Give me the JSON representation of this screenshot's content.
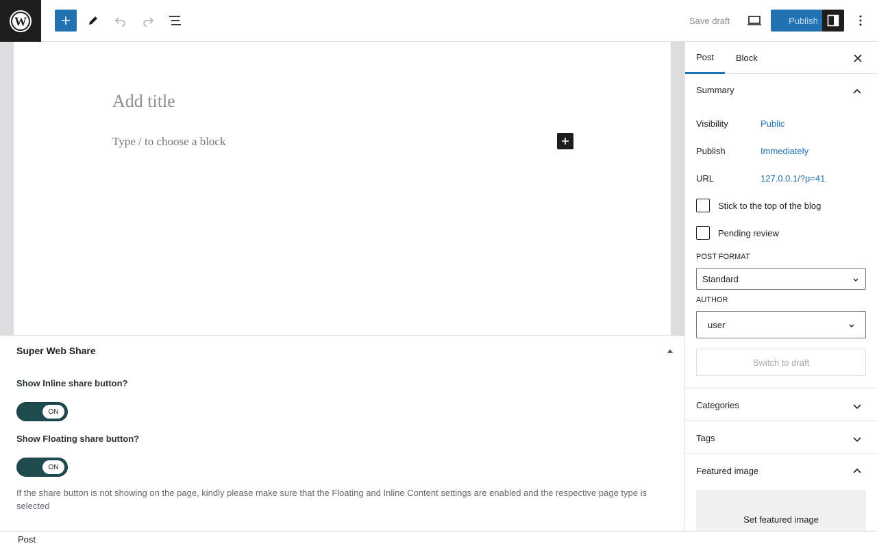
{
  "toolbar": {
    "logo_icon": "wordpress-logo",
    "save_draft": "Save draft",
    "publish": "Publish"
  },
  "editor": {
    "title_placeholder": "Add title",
    "block_placeholder": "Type / to choose a block"
  },
  "metabox": {
    "title": "Super Web Share",
    "inline_label": "Show Inline share button?",
    "inline_state": "ON",
    "floating_label": "Show Floating share button?",
    "floating_state": "ON",
    "note": "If the share button is not showing on the page, kindly please make sure that the Floating and Inline Content settings are enabled and the respective page type is selected"
  },
  "footer": {
    "breadcrumb": "Post"
  },
  "sidebar": {
    "tabs": [
      "Post",
      "Block"
    ],
    "summary": {
      "title": "Summary",
      "visibility_label": "Visibility",
      "visibility_value": "Public",
      "publish_label": "Publish",
      "publish_value": "Immediately",
      "url_label": "URL",
      "url_value": "127.0.0.1/?p=41",
      "sticky_label": "Stick to the top of the blog",
      "pending_label": "Pending review",
      "post_format_label": "POST FORMAT",
      "post_format_value": "Standard",
      "author_label": "AUTHOR",
      "author_value": "user",
      "switch_to_draft": "Switch to draft"
    },
    "categories": "Categories",
    "tags": "Tags",
    "featured_image": {
      "title": "Featured image",
      "set_label": "Set featured image"
    }
  },
  "colors": {
    "accent": "#2271b1",
    "dark": "#1e1e1e",
    "toggle_on": "#1d4b50"
  }
}
